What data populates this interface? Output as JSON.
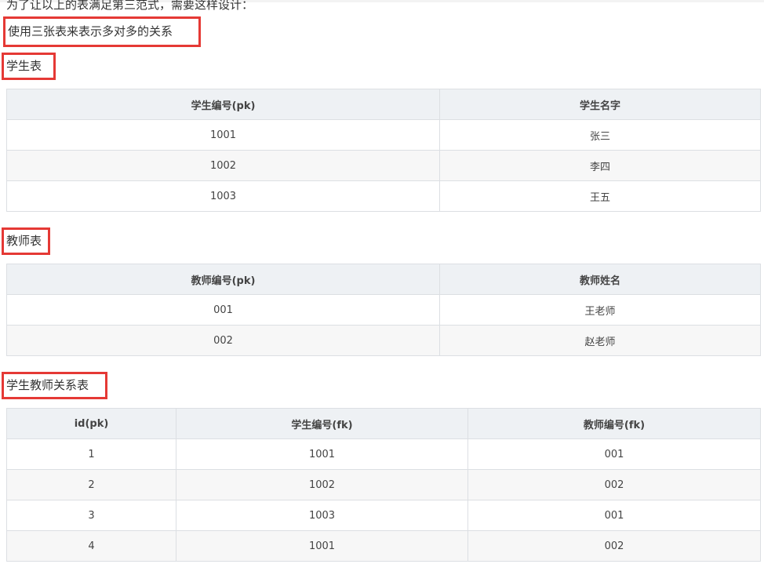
{
  "intro_text": "为了让以上的表满足第三范式，需要这样设计：",
  "note_text": "使用三张表来表示多对多的关系",
  "students": {
    "title": "学生表",
    "headers": [
      "学生编号(pk)",
      "学生名字"
    ],
    "rows": [
      [
        "1001",
        "张三"
      ],
      [
        "1002",
        "李四"
      ],
      [
        "1003",
        "王五"
      ]
    ]
  },
  "teachers": {
    "title": "教师表",
    "headers": [
      "教师编号(pk)",
      "教师姓名"
    ],
    "rows": [
      [
        "001",
        "王老师"
      ],
      [
        "002",
        "赵老师"
      ]
    ]
  },
  "relations": {
    "title": "学生教师关系表",
    "headers": [
      "id(pk)",
      "学生编号(fk)",
      "教师编号(fk)"
    ],
    "rows": [
      [
        "1",
        "1001",
        "001"
      ],
      [
        "2",
        "1002",
        "002"
      ],
      [
        "3",
        "1003",
        "001"
      ],
      [
        "4",
        "1001",
        "002"
      ]
    ]
  },
  "colors": {
    "highlight_border": "#e53935",
    "header_bg": "#eef1f4",
    "alt_row_bg": "#f7f7f7"
  }
}
